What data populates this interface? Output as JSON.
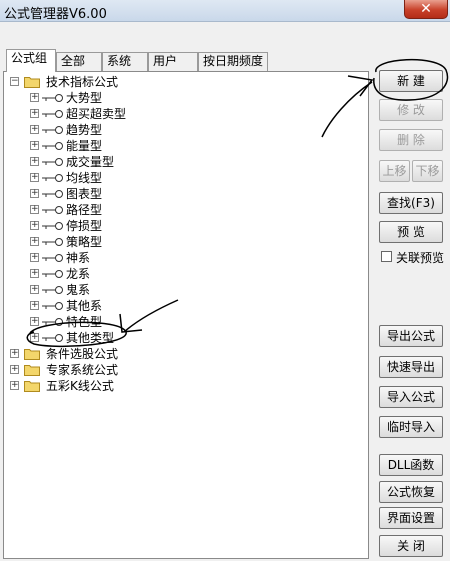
{
  "window": {
    "title": "公式管理器V6.00",
    "close_label": "✕"
  },
  "tabs": [
    "公式组",
    "全部",
    "系统",
    "用户",
    "按日期频度"
  ],
  "tree": {
    "root": "技术指标公式",
    "children": [
      "大势型",
      "超买超卖型",
      "趋势型",
      "能量型",
      "成交量型",
      "均线型",
      "图表型",
      "路径型",
      "停损型",
      "策略型",
      "神系",
      "龙系",
      "鬼系",
      "其他系",
      "特色型",
      "其他类型"
    ],
    "top_folders": [
      "条件选股公式",
      "专家系统公式",
      "五彩K线公式"
    ]
  },
  "buttons": {
    "new": "新  建",
    "edit": "修  改",
    "delete": "删  除",
    "move_up": "上移",
    "move_down": "下移",
    "find": "查找(F3)",
    "preview": "预  览",
    "linked_preview": "关联预览",
    "export": "导出公式",
    "quick_export": "快速导出",
    "import": "导入公式",
    "temp_import": "临时导入",
    "dll": "DLL函数",
    "restore": "公式恢复",
    "ui_settings": "界面设置",
    "close": "关  闭"
  }
}
